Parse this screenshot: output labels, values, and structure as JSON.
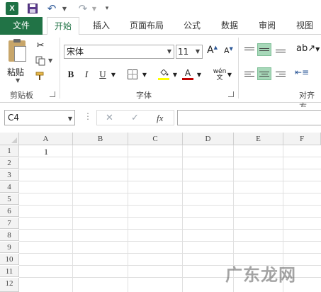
{
  "quick_access": {
    "app_icon_letter": "X",
    "save_icon": "save-icon",
    "undo_icon": "undo-icon",
    "redo_icon": "redo-icon",
    "customize_icon": "chevron-down-icon"
  },
  "tabs": [
    {
      "label": "文件"
    },
    {
      "label": "开始"
    },
    {
      "label": "插入"
    },
    {
      "label": "页面布局"
    },
    {
      "label": "公式"
    },
    {
      "label": "数据"
    },
    {
      "label": "审阅"
    },
    {
      "label": "视图"
    }
  ],
  "ribbon": {
    "clipboard": {
      "paste_label": "粘贴",
      "group_label": "剪贴板"
    },
    "font": {
      "font_name": "宋体",
      "font_size": "11",
      "bold": "B",
      "italic": "I",
      "underline": "U",
      "phonetic": "wén",
      "font_color_letter": "A",
      "grow_letter": "A",
      "shrink_letter": "A",
      "group_label": "字体",
      "fill_color": "#ffff00",
      "font_color": "#c00000"
    },
    "alignment": {
      "group_label": "对齐方"
    }
  },
  "formula_bar": {
    "name_box": "C4",
    "cancel": "✕",
    "enter": "✓",
    "fx": "fx",
    "value": ""
  },
  "sheet": {
    "columns": [
      "A",
      "B",
      "C",
      "D",
      "E",
      "F"
    ],
    "rows": [
      "1",
      "2",
      "3",
      "4",
      "5",
      "6",
      "7",
      "8",
      "9",
      "10",
      "11",
      "12"
    ],
    "selected_column": "C",
    "cells": {
      "A1": "1"
    }
  },
  "watermark": "广东龙网",
  "colors": {
    "accent": "#217346",
    "selected_align": "#a7d8b9"
  }
}
